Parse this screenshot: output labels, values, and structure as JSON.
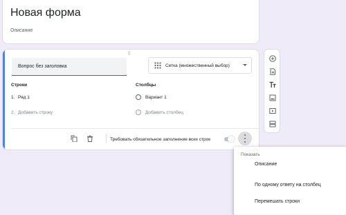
{
  "form": {
    "title": "Новая форма",
    "description_placeholder": "Описание"
  },
  "question": {
    "title": "Вопрос без заголовка",
    "type_selected": "Сетка (множественный выбор)",
    "rows_header": "Строки",
    "columns_header": "Столбцы",
    "rows": [
      {
        "index": "1.",
        "label": "Ряд 1"
      },
      {
        "index": "2.",
        "label": "Добавить строку"
      }
    ],
    "columns": [
      {
        "label": "Вариант 1"
      },
      {
        "label": "Добавить столбец"
      }
    ],
    "required_label": "Требовать обязательное заполнение всех строк",
    "required_toggle": false
  },
  "toolbar": {
    "icons": [
      "add-question-icon",
      "import-questions-icon",
      "add-title-icon",
      "add-image-icon",
      "add-video-icon",
      "add-section-icon"
    ]
  },
  "menu": {
    "header": "Показать",
    "items": [
      {
        "label": "Описание"
      },
      {
        "label": "По одному ответу на столбец"
      },
      {
        "label": "Перемешать строки"
      }
    ]
  },
  "colors": {
    "background": "#f0ebf8",
    "accent_purple": "#673ab7",
    "active_blue": "#4285f4"
  }
}
